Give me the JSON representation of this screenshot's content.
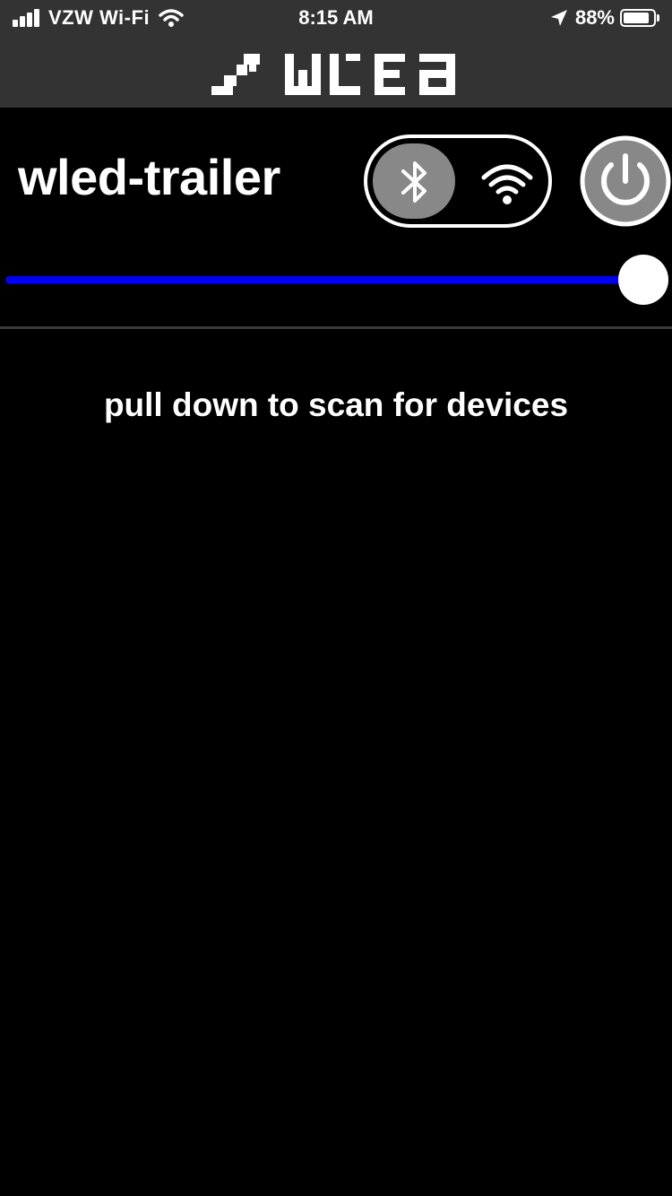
{
  "status_bar": {
    "carrier": "VZW Wi-Fi",
    "time": "8:15 AM",
    "battery_percent": "88%",
    "battery_level": 0.88,
    "icons": [
      "signal-bars-icon",
      "wifi-icon",
      "location-arrow-icon",
      "battery-icon"
    ]
  },
  "header": {
    "logo": "WLED",
    "logo_icon": "wled-logo"
  },
  "device": {
    "name": "wled-trailer",
    "connection_mode": "bluetooth",
    "connection_options": [
      "bluetooth-icon",
      "wifi-icon"
    ],
    "power_icon": "power-icon"
  },
  "brightness": {
    "value_fraction": 1.0,
    "track_color": "#0000ff"
  },
  "list": {
    "empty_hint": "pull down to scan for devices"
  },
  "colors": {
    "background": "#000000",
    "bar": "#333333",
    "accent": "#0000ff",
    "knob": "#888888"
  }
}
